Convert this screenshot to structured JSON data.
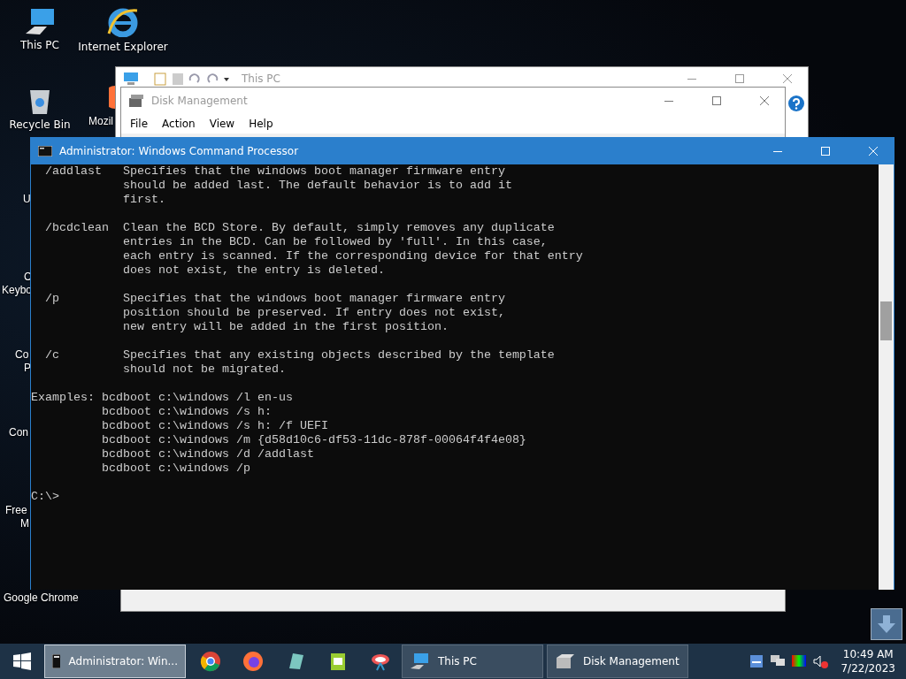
{
  "desktop_icons": [
    {
      "kind": "pc",
      "label": "This PC"
    },
    {
      "kind": "ie",
      "label": "Internet Explorer"
    },
    {
      "kind": "bin",
      "label": "Recycle Bin"
    },
    {
      "kind": "fox",
      "label": "Mozil"
    },
    {
      "kind": "none",
      "label": "U"
    },
    {
      "kind": "none",
      "label": "C"
    },
    {
      "kind": "none",
      "label": "Keybo"
    },
    {
      "kind": "none",
      "label": "Co"
    },
    {
      "kind": "none",
      "label": "P"
    },
    {
      "kind": "none",
      "label": "Con"
    },
    {
      "kind": "none",
      "label": "Free"
    },
    {
      "kind": "none",
      "label": "M"
    },
    {
      "kind": "none",
      "label": "Google Chrome"
    }
  ],
  "explorer_window": {
    "title": "This PC"
  },
  "disk_window": {
    "title": "Disk Management",
    "menu": [
      "File",
      "Action",
      "View",
      "Help"
    ]
  },
  "console": {
    "title": "Administrator: Windows Command Processor",
    "blocks": [
      [
        "  /addlast   Specifies that the windows boot manager firmware entry",
        "             should be added last. The default behavior is to add it",
        "             first."
      ],
      [
        "  /bcdclean  Clean the BCD Store. By default, simply removes any duplicate",
        "             entries in the BCD. Can be followed by 'full'. In this case,",
        "             each entry is scanned. If the corresponding device for that entry",
        "             does not exist, the entry is deleted."
      ],
      [
        "  /p         Specifies that the windows boot manager firmware entry",
        "             position should be preserved. If entry does not exist,",
        "             new entry will be added in the first position."
      ],
      [
        "  /c         Specifies that any existing objects described by the template",
        "             should not be migrated."
      ],
      [
        "Examples: bcdboot c:\\windows /l en-us",
        "          bcdboot c:\\windows /s h:",
        "          bcdboot c:\\windows /s h: /f UEFI",
        "          bcdboot c:\\windows /m {d58d10c6-df53-11dc-878f-00064f4f4e08}",
        "          bcdboot c:\\windows /d /addlast",
        "          bcdboot c:\\windows /p"
      ],
      [
        "C:\\>"
      ]
    ]
  },
  "taskbar": {
    "items": [
      {
        "kind": "cmd",
        "label": "Administrator: Win...",
        "selected": true
      },
      {
        "kind": "chrome"
      },
      {
        "kind": "firefox"
      },
      {
        "kind": "notes"
      },
      {
        "kind": "notepad"
      },
      {
        "kind": "tool"
      },
      {
        "kind": "pc",
        "label": "This PC",
        "selected": false
      },
      {
        "kind": "disk",
        "label": "Disk Management",
        "selected": false
      }
    ],
    "time": "10:49 AM",
    "date": "7/22/2023"
  }
}
